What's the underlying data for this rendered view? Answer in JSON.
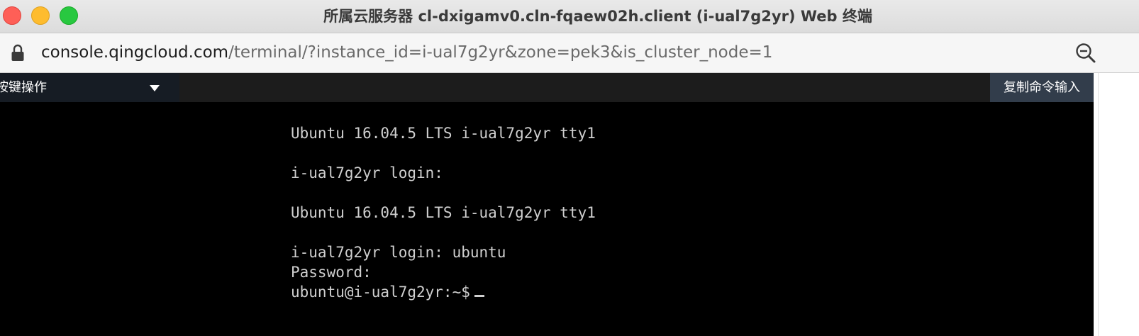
{
  "window": {
    "title": "所属云服务器 cl-dxigamv0.cln-fqaew02h.client (i-ual7g2yr) Web 终端"
  },
  "addressbar": {
    "host": "console.qingcloud.com",
    "path": "/terminal/?instance_id=i-ual7g2yr&zone=pek3&is_cluster_node=1"
  },
  "toolbar": {
    "key_select_label": "按键操作",
    "copy_command_label": "复制命令输入"
  },
  "terminal": {
    "lines": [
      "Ubuntu 16.04.5 LTS i-ual7g2yr tty1",
      "i-ual7g2yr login:",
      "Ubuntu 16.04.5 LTS i-ual7g2yr tty1",
      "i-ual7g2yr login: ubuntu",
      "Password:",
      "ubuntu@i-ual7g2yr:~$"
    ]
  },
  "colors": {
    "close": "#fe5f57",
    "minimize": "#febc2e",
    "maximize": "#28c840",
    "terminal_bg": "#000000",
    "terminal_fg": "#cfcfcf",
    "button_bg": "#323d4b"
  },
  "icons": {
    "lock": "lock-icon",
    "zoom": "zoom-out-icon",
    "dropdown": "triangle-down-icon"
  }
}
